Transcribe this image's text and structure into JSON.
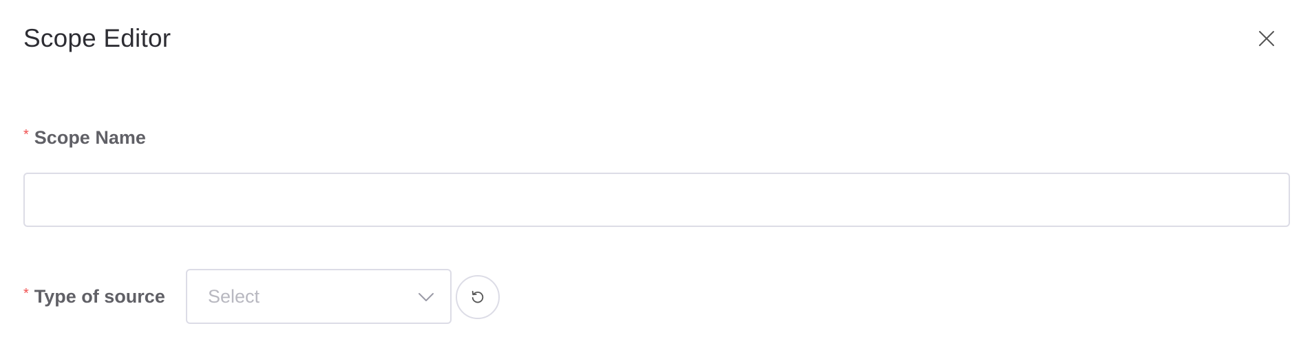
{
  "dialog": {
    "title": "Scope Editor",
    "close_icon": "close-icon"
  },
  "form": {
    "scope_name": {
      "required_marker": "*",
      "label": "Scope Name",
      "value": "",
      "placeholder": ""
    },
    "type_of_source": {
      "required_marker": "*",
      "label": "Type of source",
      "placeholder": "Select",
      "caret_icon": "chevron-down-icon",
      "reset_icon": "refresh-icon"
    }
  },
  "colors": {
    "required": "#f05050",
    "border": "#dcdce6",
    "label": "#606066",
    "title": "#2d2d33",
    "placeholder": "#b8b8c0"
  }
}
